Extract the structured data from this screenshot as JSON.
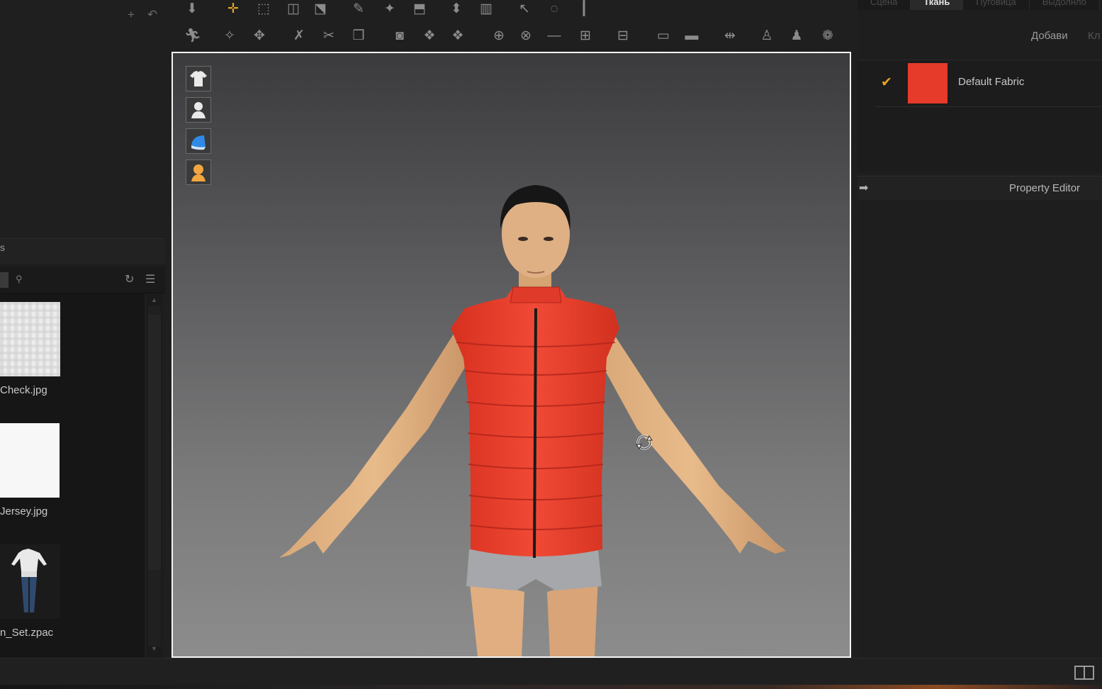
{
  "left_panel": {
    "top_icons": [
      "plus-icon",
      "undo-icon"
    ],
    "library_label": "s",
    "files": [
      {
        "name": "Check.jpg"
      },
      {
        "name": "Jersey.jpg"
      },
      {
        "name": "n_Set.zpac"
      }
    ]
  },
  "right_panel": {
    "tabs": [
      "Сцена",
      "Ткань",
      "Пуговица",
      "Выдолнло"
    ],
    "active_tab": "Ткань",
    "add_button": "Добави",
    "add_button2": "Кл",
    "fabric": {
      "name": "Default Fabric",
      "color": "#e63a2a",
      "checked": true
    },
    "property_editor": "Property Editor"
  },
  "colors": {
    "accent": "#e3a52a",
    "vest": "#e8392b",
    "viewport_border": "#f4f4f4"
  }
}
